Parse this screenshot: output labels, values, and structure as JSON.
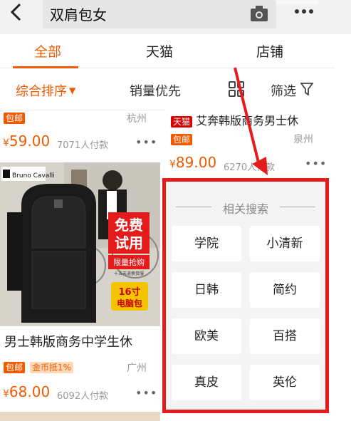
{
  "search": {
    "query": "双肩包女"
  },
  "tabs": [
    {
      "label": "全部"
    },
    {
      "label": "天猫"
    },
    {
      "label": "店铺"
    }
  ],
  "sort": {
    "comprehensive": "综合排序",
    "sales": "销量优先",
    "filter": "筛选"
  },
  "left_top_card": {
    "badge": "包邮",
    "location": "杭州",
    "price_symbol": "¥",
    "price": "59.00",
    "sold": "7071人付款"
  },
  "left_product": {
    "brand_logo": "Bruno Cavalli",
    "promo_line1": "免费",
    "promo_line2": "试用",
    "promo_line3": "限量抢购",
    "promo_line4": "十五天退换货服",
    "size_badge": "16寸",
    "size_badge2": "电脑包",
    "title": "男士韩版商务中学生休",
    "badge1": "包邮",
    "badge2": "金币抵1%",
    "location": "广州",
    "price_symbol": "¥",
    "price": "68.00",
    "sold": "6092人付款"
  },
  "right_top_card": {
    "tmall_badge": "天猫",
    "title": "艾奔韩版商务男士休",
    "badge": "包邮",
    "location": "泉州",
    "price_symbol": "¥",
    "price": "89.00",
    "sold": "6270人付款"
  },
  "related_search": {
    "title": "相关搜索",
    "terms": [
      "学院",
      "小清新",
      "日韩",
      "简约",
      "欧美",
      "百搭",
      "真皮",
      "英伦"
    ]
  },
  "colors": {
    "accent": "#f25a00",
    "highlight_border": "#e51c1c",
    "tmall": "#d80000"
  }
}
